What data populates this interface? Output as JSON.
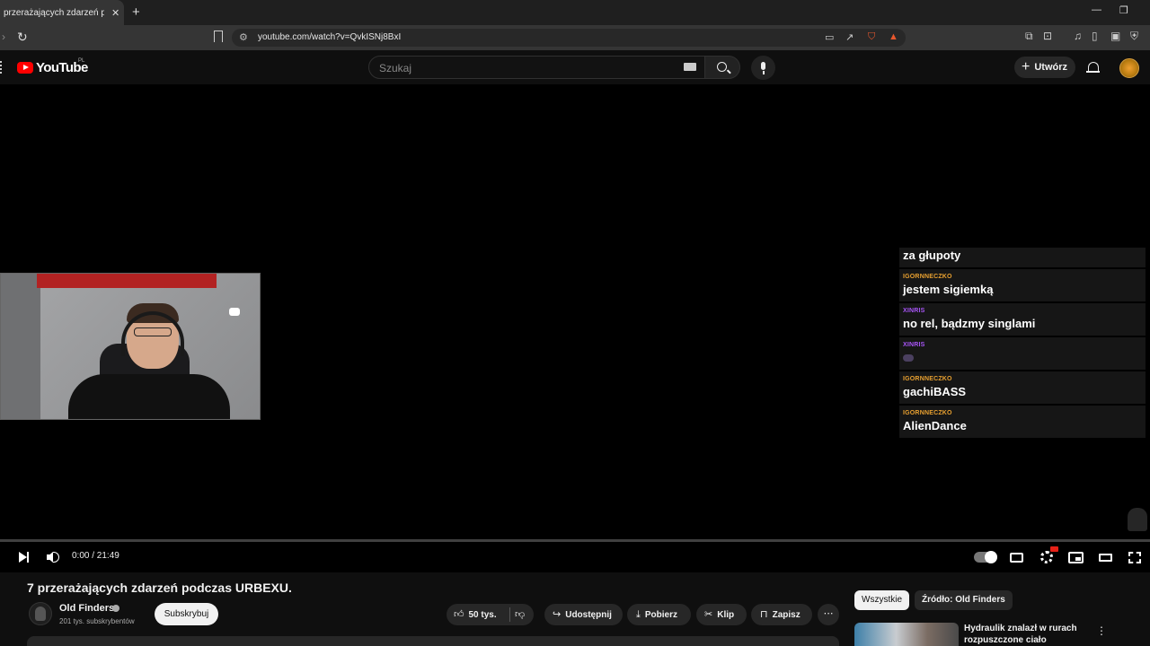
{
  "browser": {
    "tab_title": "przerażających zdarzeń podczas",
    "url": "youtube.com/watch?v=QvkISNj8BxI"
  },
  "header": {
    "logo": "YouTube",
    "country": "PL",
    "search_placeholder": "Szukaj",
    "create_label": "Utwórz"
  },
  "player": {
    "time": "0:00 / 21:49",
    "progress": 0
  },
  "chat": [
    {
      "user": "",
      "text": "za głupoty",
      "color": "#ffffff"
    },
    {
      "user": "IGORNNECZKO",
      "text": "jestem sigiemką",
      "color": "#e8a030"
    },
    {
      "user": "XINRIS",
      "text": "no rel, bądzmy singlami",
      "color": "#a855f7"
    },
    {
      "user": "XINRIS",
      "text": "",
      "color": "#a855f7"
    },
    {
      "user": "IGORNNECZKO",
      "text": "gachiBASS",
      "color": "#e8a030"
    },
    {
      "user": "IGORNNECZKO",
      "text": "AlienDance",
      "color": "#e8a030"
    }
  ],
  "video": {
    "title": "7 przerażających zdarzeń podczas URBEXU.",
    "channel": "Old Finders",
    "subscribers": "201 tys. subskrybentów",
    "subscribe_label": "Subskrybuj",
    "likes": "50 tys.",
    "share_label": "Udostępnij",
    "download_label": "Pobierz",
    "clip_label": "Klip",
    "save_label": "Zapisz"
  },
  "sidebar": {
    "chips": [
      "Wszystkie",
      "Źródło: Old Finders"
    ],
    "recommendation_title": "Hydraulik znalazł w rurach rozpuszczone ciało"
  }
}
